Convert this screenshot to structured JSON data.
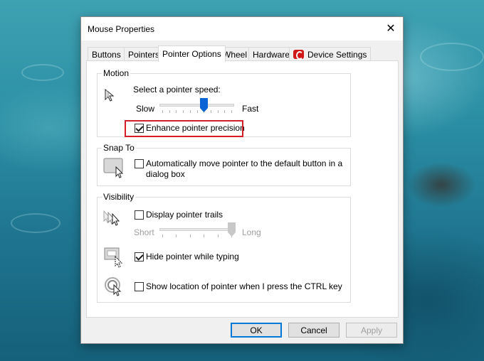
{
  "window": {
    "title": "Mouse Properties"
  },
  "tabs": [
    {
      "label": "Buttons",
      "active": false
    },
    {
      "label": "Pointers",
      "active": false
    },
    {
      "label": "Pointer Options",
      "active": true
    },
    {
      "label": "Wheel",
      "active": false
    },
    {
      "label": "Hardware",
      "active": false
    },
    {
      "label": "Device Settings",
      "active": false,
      "icon": "device-settings-icon"
    }
  ],
  "motion": {
    "group_label": "Motion",
    "speed_label": "Select a pointer speed:",
    "slow_label": "Slow",
    "fast_label": "Fast",
    "speed_value_fraction": 0.6,
    "enhance_label": "Enhance pointer precision",
    "enhance_checked": true
  },
  "snap_to": {
    "group_label": "Snap To",
    "auto_move_label_line1": "Automatically move pointer to the default button in a",
    "auto_move_label_line2": "dialog box",
    "auto_move_checked": false
  },
  "visibility": {
    "group_label": "Visibility",
    "trails_label": "Display pointer trails",
    "trails_checked": false,
    "short_label": "Short",
    "long_label": "Long",
    "trail_length_fraction": 1.0,
    "hide_typing_label": "Hide pointer while typing",
    "hide_typing_checked": true,
    "show_location_label": "Show location of pointer when I press the CTRL key",
    "show_location_checked": false
  },
  "buttons": {
    "ok": "OK",
    "cancel": "Cancel",
    "apply": "Apply"
  },
  "colors": {
    "accent": "#0078d7",
    "slider_thumb": "#0a64d6",
    "highlight": "#d21f2a"
  }
}
